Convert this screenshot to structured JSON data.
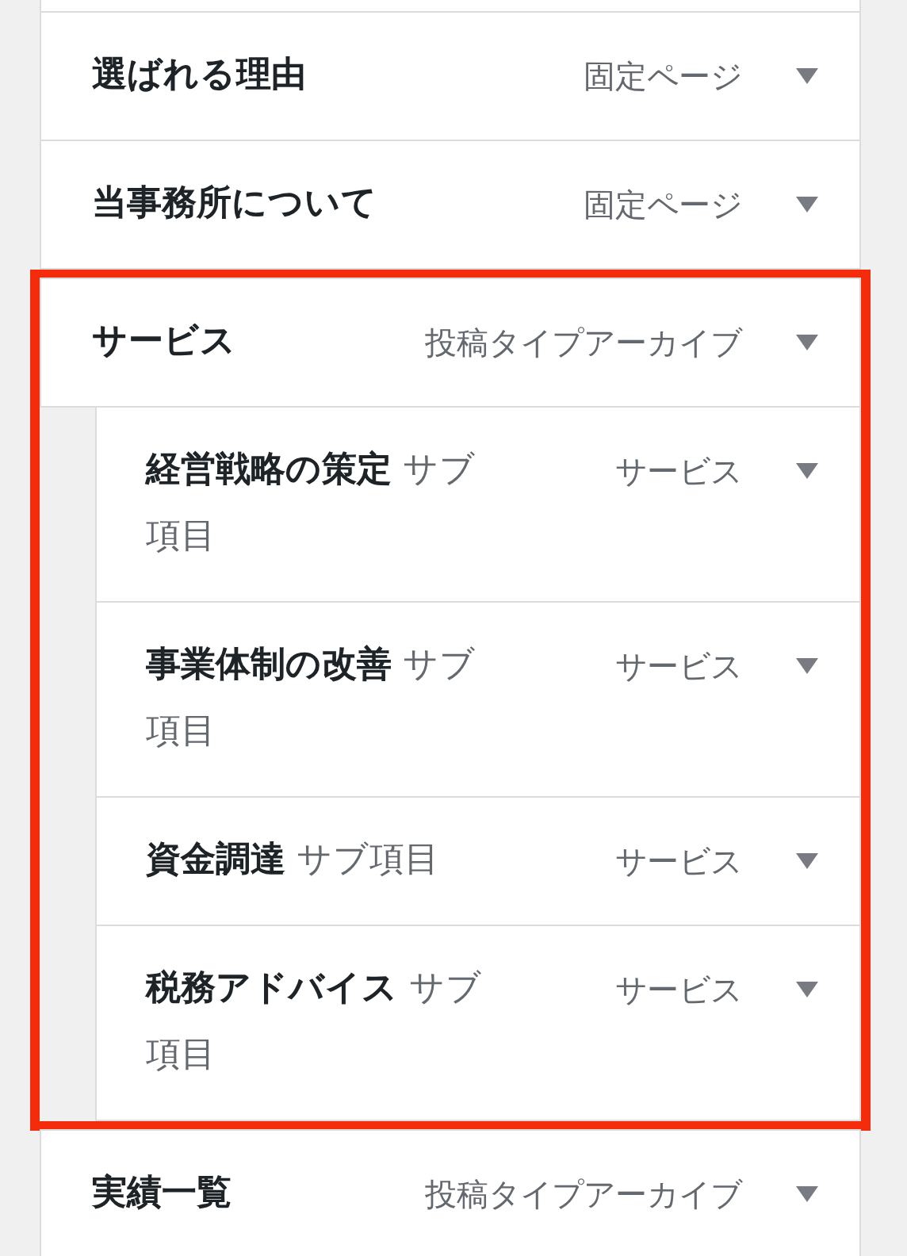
{
  "menu_items": [
    {
      "title": "選ばれる理由",
      "type_label": "固定ページ",
      "highlighted": false
    },
    {
      "title": "当事務所について",
      "type_label": "固定ページ",
      "highlighted": false
    },
    {
      "title": "サービス",
      "type_label": "投稿タイプアーカイブ",
      "highlighted": true,
      "children": [
        {
          "title": "経営戦略の策定",
          "sub_label": "サブ項目",
          "type_label": "サービス"
        },
        {
          "title": "事業体制の改善",
          "sub_label": "サブ項目",
          "type_label": "サービス"
        },
        {
          "title": "資金調達",
          "sub_label": "サブ項目",
          "type_label": "サービス"
        },
        {
          "title": "税務アドバイス",
          "sub_label": "サブ項目",
          "type_label": "サービス"
        }
      ]
    },
    {
      "title": "実績一覧",
      "type_label": "投稿タイプアーカイブ",
      "highlighted": false
    }
  ]
}
